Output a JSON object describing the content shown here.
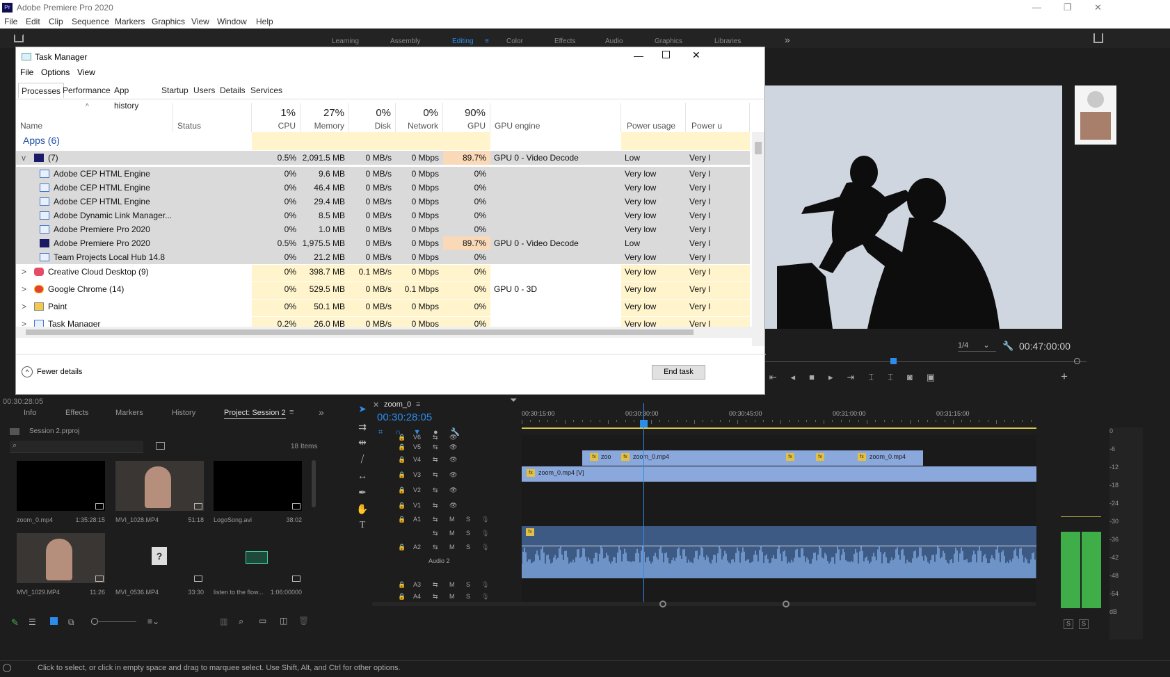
{
  "app": {
    "title": "Adobe Premiere Pro 2020",
    "logo": "Pr"
  },
  "window_controls": {
    "minimize": "—",
    "maximize": "❐",
    "close": "✕"
  },
  "menu": [
    "File",
    "Edit",
    "Clip",
    "Sequence",
    "Markers",
    "Graphics",
    "View",
    "Window",
    "Help"
  ],
  "workspaces": {
    "items": [
      "Learning",
      "Assembly",
      "Editing",
      "Color",
      "Effects",
      "Audio",
      "Graphics",
      "Libraries"
    ],
    "active": "Editing",
    "more": "»"
  },
  "task_manager": {
    "title": "Task Manager",
    "menu": [
      "File",
      "Options",
      "View"
    ],
    "tabs": [
      "Processes",
      "Performance",
      "App history",
      "Startup",
      "Users",
      "Details",
      "Services"
    ],
    "active_tab": "Processes",
    "columns": [
      {
        "label": "Name",
        "pct": ""
      },
      {
        "label": "Status",
        "pct": ""
      },
      {
        "label": "CPU",
        "pct": "1%"
      },
      {
        "label": "Memory",
        "pct": "27%"
      },
      {
        "label": "Disk",
        "pct": "0%"
      },
      {
        "label": "Network",
        "pct": "0%"
      },
      {
        "label": "GPU",
        "pct": "90%"
      },
      {
        "label": "GPU engine",
        "pct": ""
      },
      {
        "label": "Power usage",
        "pct": ""
      },
      {
        "label": "Power u",
        "pct": ""
      }
    ],
    "group": "Apps (6)",
    "rows": [
      {
        "name": "(7)",
        "cpu": "0.5%",
        "mem": "2,091.5 MB",
        "disk": "0 MB/s",
        "net": "0 Mbps",
        "gpu": "89.7%",
        "eng": "GPU 0 - Video Decode",
        "pow": "Low",
        "pow2": "Very l",
        "lvl": 0,
        "icon": "premiere-icon",
        "expand": "v"
      },
      {
        "name": "Adobe CEP HTML Engine",
        "cpu": "0%",
        "mem": "9.6 MB",
        "disk": "0 MB/s",
        "net": "0 Mbps",
        "gpu": "0%",
        "eng": "",
        "pow": "Very low",
        "pow2": "Very l",
        "lvl": 1,
        "icon": "window-icon",
        "expand": ""
      },
      {
        "name": "Adobe CEP HTML Engine",
        "cpu": "0%",
        "mem": "46.4 MB",
        "disk": "0 MB/s",
        "net": "0 Mbps",
        "gpu": "0%",
        "eng": "",
        "pow": "Very low",
        "pow2": "Very l",
        "lvl": 1,
        "icon": "window-icon",
        "expand": ""
      },
      {
        "name": "Adobe CEP HTML Engine",
        "cpu": "0%",
        "mem": "29.4 MB",
        "disk": "0 MB/s",
        "net": "0 Mbps",
        "gpu": "0%",
        "eng": "",
        "pow": "Very low",
        "pow2": "Very l",
        "lvl": 1,
        "icon": "window-icon",
        "expand": ""
      },
      {
        "name": "Adobe Dynamic Link Manager...",
        "cpu": "0%",
        "mem": "8.5 MB",
        "disk": "0 MB/s",
        "net": "0 Mbps",
        "gpu": "0%",
        "eng": "",
        "pow": "Very low",
        "pow2": "Very l",
        "lvl": 1,
        "icon": "window-icon",
        "expand": ""
      },
      {
        "name": "Adobe Premiere Pro 2020",
        "cpu": "0%",
        "mem": "1.0 MB",
        "disk": "0 MB/s",
        "net": "0 Mbps",
        "gpu": "0%",
        "eng": "",
        "pow": "Very low",
        "pow2": "Very l",
        "lvl": 1,
        "icon": "window-icon",
        "expand": ""
      },
      {
        "name": "Adobe Premiere Pro 2020",
        "cpu": "0.5%",
        "mem": "1,975.5 MB",
        "disk": "0 MB/s",
        "net": "0 Mbps",
        "gpu": "89.7%",
        "eng": "GPU 0 - Video Decode",
        "pow": "Low",
        "pow2": "Very l",
        "lvl": 1,
        "icon": "premiere-icon",
        "expand": ""
      },
      {
        "name": "Team Projects Local Hub 14.8",
        "cpu": "0%",
        "mem": "21.2 MB",
        "disk": "0 MB/s",
        "net": "0 Mbps",
        "gpu": "0%",
        "eng": "",
        "pow": "Very low",
        "pow2": "Very l",
        "lvl": 1,
        "icon": "window-icon",
        "expand": ""
      },
      {
        "name": "Creative Cloud Desktop (9)",
        "cpu": "0%",
        "mem": "398.7 MB",
        "disk": "0.1 MB/s",
        "net": "0 Mbps",
        "gpu": "0%",
        "eng": "",
        "pow": "Very low",
        "pow2": "Very l",
        "lvl": 0,
        "icon": "creative-cloud-icon",
        "expand": ">"
      },
      {
        "name": "Google Chrome (14)",
        "cpu": "0%",
        "mem": "529.5 MB",
        "disk": "0 MB/s",
        "net": "0.1 Mbps",
        "gpu": "0%",
        "eng": "GPU 0 - 3D",
        "pow": "Very low",
        "pow2": "Very l",
        "lvl": 0,
        "icon": "chrome-icon",
        "expand": ">"
      },
      {
        "name": "Paint",
        "cpu": "0%",
        "mem": "50.1 MB",
        "disk": "0 MB/s",
        "net": "0 Mbps",
        "gpu": "0%",
        "eng": "",
        "pow": "Very low",
        "pow2": "Very l",
        "lvl": 0,
        "icon": "paint-icon",
        "expand": ">"
      },
      {
        "name": "Task Manager",
        "cpu": "0.2%",
        "mem": "26.0 MB",
        "disk": "0 MB/s",
        "net": "0 Mbps",
        "gpu": "0%",
        "eng": "",
        "pow": "Very low",
        "pow2": "Very l",
        "lvl": 0,
        "icon": "taskmgr-icon",
        "expand": ">"
      }
    ],
    "fewer_details": "Fewer details",
    "end_task": "End task"
  },
  "program": {
    "page": "1/4",
    "timecode": "00:47:00:00",
    "left_timecode": "00:30:28:05"
  },
  "project_panel": {
    "tabs": [
      "Info",
      "Effects",
      "Markers",
      "History",
      "Project: Session 2"
    ],
    "active_tab": "Project: Session 2",
    "project_file": "Session 2.prproj",
    "items_count": "18 Items",
    "search_placeholder": "",
    "items": [
      {
        "name": "zoom_0.mp4",
        "dur": "1:35:28:15",
        "kind": "black"
      },
      {
        "name": "MVI_1028.MP4",
        "dur": "51:18",
        "kind": "person"
      },
      {
        "name": "LogoSong.avi",
        "dur": "38:02",
        "kind": "black"
      },
      {
        "name": "MVI_1029.MP4",
        "dur": "11:26",
        "kind": "person"
      },
      {
        "name": "MVI_0536.MP4",
        "dur": "33:30",
        "kind": "missing"
      },
      {
        "name": "listen to the flow...",
        "dur": "1:06:00000",
        "kind": "audio"
      }
    ]
  },
  "timeline": {
    "sequence_name": "zoom_0",
    "playhead": "00:30:28:05",
    "ruler": [
      "00:30:15:00",
      "00:30:30:00",
      "00:30:45:00",
      "00:31:00:00",
      "00:31:15:00"
    ],
    "video_tracks": [
      "V6",
      "V5",
      "V4",
      "V3",
      "V2",
      "V1"
    ],
    "audio_tracks": [
      "A1",
      "A2",
      "A3",
      "A4"
    ],
    "audio2_label": "Audio 2",
    "clips": {
      "v4_a": "zoo",
      "v4_b": "zoom_0.mp4",
      "v4_c": "zoom_0.mp4",
      "v3": "zoom_0.mp4 [V]"
    },
    "mute": "M",
    "solo": "S"
  },
  "meter": {
    "scale": [
      "0",
      "-6",
      "-12",
      "-18",
      "-24",
      "-30",
      "-36",
      "-42",
      "-48",
      "-54",
      "dB"
    ],
    "solo_labels": [
      "S",
      "S"
    ]
  },
  "status": "Click to select, or click in empty space and drag to marquee select. Use Shift, Alt, and Ctrl for other options."
}
